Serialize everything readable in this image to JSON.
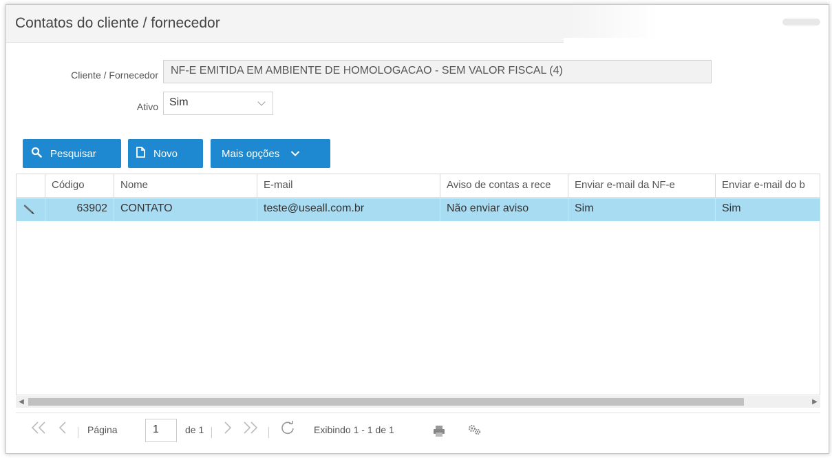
{
  "window": {
    "title": "Contatos do cliente / fornecedor"
  },
  "form": {
    "cliente_label": "Cliente / Fornecedor",
    "cliente_value": "NF-E EMITIDA EM AMBIENTE DE HOMOLOGACAO - SEM VALOR FISCAL (4)",
    "ativo_label": "Ativo",
    "ativo_value": "Sim"
  },
  "toolbar": {
    "pesquisar_label": "Pesquisar",
    "novo_label": "Novo",
    "mais_opcoes_label": "Mais opções",
    "icons": [
      "search-icon",
      "document-icon",
      "chevron-down-icon"
    ]
  },
  "grid": {
    "columns": [
      "Código",
      "Nome",
      "E-mail",
      "Aviso de contas a rece",
      "Enviar e-mail da NF-e",
      "Enviar e-mail do b"
    ],
    "rows": [
      {
        "codigo": "63902",
        "nome": "CONTATO",
        "email": "teste@useall.com.br",
        "aviso": "Não enviar aviso",
        "email_nfe": "Sim",
        "email_b": "Sim"
      }
    ],
    "row_icon": "pencil-icon"
  },
  "pager": {
    "pagina_label": "Página",
    "page_value": "1",
    "of_label": "de 1",
    "exibindo": "Exibindo 1 - 1 de 1",
    "icons": [
      "first-page-icon",
      "prev-page-icon",
      "next-page-icon",
      "last-page-icon",
      "refresh-icon",
      "print-icon",
      "settings-icon"
    ]
  },
  "colors": {
    "accent": "#1e88d0",
    "selected_row": "#a8dcf2"
  }
}
